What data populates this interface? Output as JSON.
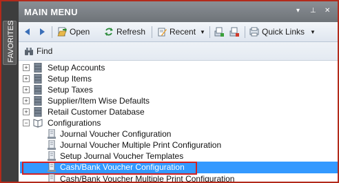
{
  "sidebar": {
    "favorites_label": "FAVORITES"
  },
  "window": {
    "title": "MAIN MENU"
  },
  "toolbar": {
    "open_label": "Open",
    "refresh_label": "Refresh",
    "recent_label": "Recent",
    "quick_links_label": "Quick Links"
  },
  "find": {
    "label": "Find"
  },
  "tree": {
    "items": [
      {
        "label": "Setup Accounts",
        "expander": "+"
      },
      {
        "label": "Setup Items",
        "expander": "+"
      },
      {
        "label": "Setup Taxes",
        "expander": "+"
      },
      {
        "label": "Supplier/Item Wise Defaults",
        "expander": "+"
      },
      {
        "label": "Retail Customer Database",
        "expander": "+"
      },
      {
        "label": "Configurations",
        "expander": "−"
      }
    ],
    "children": [
      {
        "label": "Journal Voucher Configuration"
      },
      {
        "label": "Journal Voucher Multiple Print Configuration"
      },
      {
        "label": "Setup Journal Voucher Templates"
      },
      {
        "label": "Cash/Bank Voucher Configuration",
        "selected": true
      },
      {
        "label": "Cash/Bank Voucher Multiple Print Configuration"
      }
    ]
  },
  "colors": {
    "selection": "#3399ff",
    "highlight_outline": "#d42020",
    "titlebar": "#7a7f85"
  }
}
